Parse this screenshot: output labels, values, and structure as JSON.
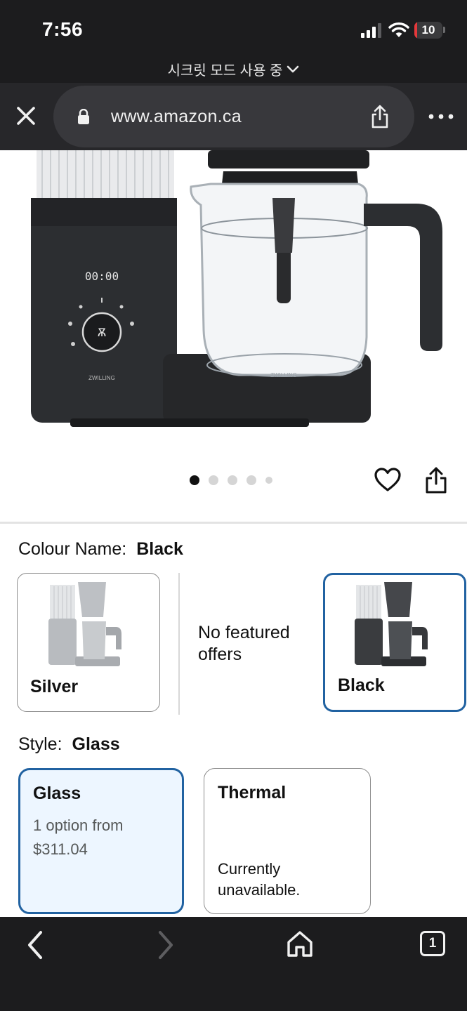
{
  "status_bar": {
    "time": "7:56",
    "battery_level": "10",
    "battery_fraction": 0.1
  },
  "browser": {
    "incognito_text": "시크릿 모드 사용 중",
    "url": "www.amazon.ca",
    "icons": [
      "close-icon",
      "lock-icon",
      "share-icon",
      "more-icon",
      "chevron-down-icon"
    ]
  },
  "gallery": {
    "image_count": 5,
    "active_index": 0
  },
  "colour": {
    "label": "Colour Name:",
    "selected": "Black",
    "options": [
      {
        "label": "Silver"
      },
      {
        "label": "No featured offers"
      },
      {
        "label": "Black"
      }
    ]
  },
  "style": {
    "label": "Style:",
    "selected": "Glass",
    "options": [
      {
        "name": "Glass",
        "line1": "1 option from",
        "price": "$311.04"
      },
      {
        "name": "Thermal",
        "line1": "Currently",
        "line2": "unavailable."
      }
    ]
  },
  "toolbar": {
    "tab_count": "1"
  },
  "colors": {
    "selected_border": "#2162a1",
    "selected_bg": "#edf6ff",
    "bar_bg": "#1c1c1e"
  }
}
